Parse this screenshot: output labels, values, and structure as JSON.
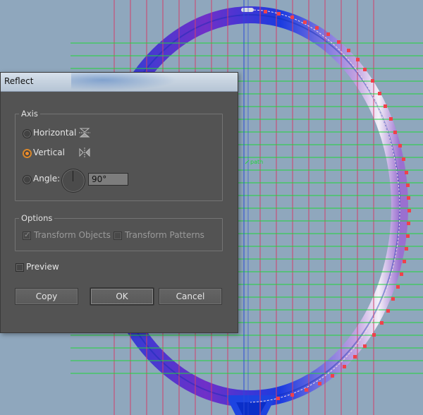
{
  "dialog": {
    "title": "Reflect",
    "axis": {
      "label": "Axis",
      "horizontal_label": "Horizontal",
      "vertical_label": "Vertical",
      "angle_label": "Angle:",
      "angle_value": "90°",
      "selected": "Vertical"
    },
    "options": {
      "label": "Options",
      "transform_objects_label": "Transform Objects",
      "transform_objects_checked": true,
      "transform_patterns_label": "Transform Patterns",
      "transform_patterns_checked": false
    },
    "preview_label": "Preview",
    "preview_checked": false,
    "buttons": {
      "copy": "Copy",
      "ok": "OK",
      "cancel": "Cancel"
    }
  },
  "canvas": {
    "path_label": "path",
    "colors": {
      "background": "#8fa7bd",
      "racket_frame": "#1637c9",
      "guide_vertical": "#d0406a",
      "guide_horizontal": "#22d43a",
      "anchor_points": "#f0414b",
      "selection_line": "#2b4bd8"
    }
  }
}
